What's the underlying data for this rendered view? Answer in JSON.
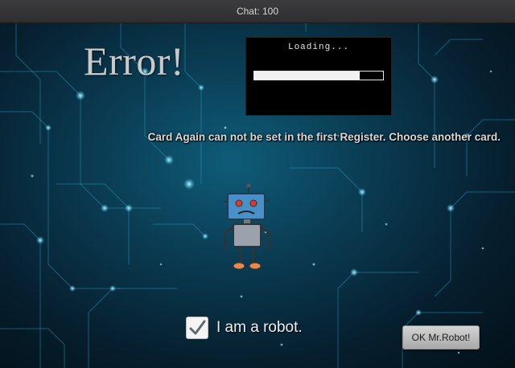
{
  "window": {
    "title": "Chat: 100"
  },
  "dialog": {
    "error_title": "Error!",
    "loading_text": "Loading...",
    "progress": 0.82,
    "message": "Card Again can not be set in the first Register. Choose another card.",
    "robot_icon": "robot-icon",
    "checkbox_label": "I am a robot.",
    "checkbox_checked": true,
    "ok_button_label": "OK Mr.Robot!"
  },
  "colors": {
    "background_accent": "#0a3b52",
    "circuit_glow": "#3fd0ff",
    "robot_head": "#4a90c8",
    "robot_body": "#9aa3ad",
    "robot_eyes": "#e0392b",
    "robot_feet": "#e8894a"
  }
}
